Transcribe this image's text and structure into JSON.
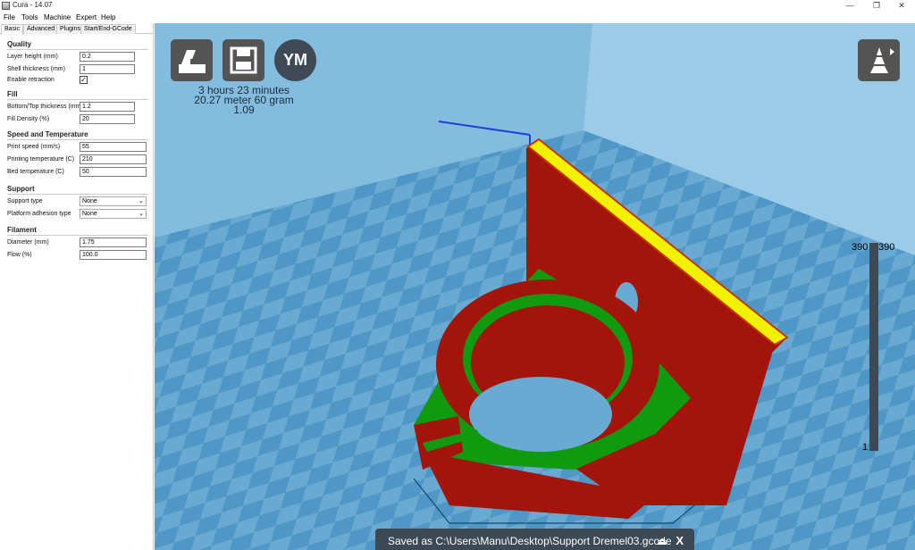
{
  "window": {
    "title": "Cura - 14.07",
    "minimize": "—",
    "restore": "❐",
    "close": "✕"
  },
  "menu": [
    "File",
    "Tools",
    "Machine",
    "Expert",
    "Help"
  ],
  "tabs": [
    "Basic",
    "Advanced",
    "Plugins",
    "Start/End-GCode"
  ],
  "sections": {
    "quality": "Quality",
    "fill": "Fill",
    "speed": "Speed and Temperature",
    "support": "Support",
    "filament": "Filament"
  },
  "fields": {
    "layer_height": {
      "label": "Layer height (mm)",
      "value": "0.2"
    },
    "shell_thickness": {
      "label": "Shell thickness (mm)",
      "value": "1"
    },
    "enable_retraction": {
      "label": "Enable retraction",
      "checked": "✓"
    },
    "bottom_top": {
      "label": "Bottom/Top thickness (mm)",
      "value": "1.2"
    },
    "fill_density": {
      "label": "Fill Density (%)",
      "value": "20"
    },
    "print_speed": {
      "label": "Print speed (mm/s)",
      "value": "55"
    },
    "print_temp": {
      "label": "Printing temperature (C)",
      "value": "210"
    },
    "bed_temp": {
      "label": "Bed temperature (C)",
      "value": "50"
    },
    "support_type": {
      "label": "Support type",
      "value": "None"
    },
    "platform_adhesion": {
      "label": "Platform adhesion type",
      "value": "None"
    },
    "diameter": {
      "label": "Diameter (mm)",
      "value": "1.75"
    },
    "flow": {
      "label": "Flow (%)",
      "value": "100.0"
    }
  },
  "viewport": {
    "ym_label": "YM",
    "print_time": "3 hours 23 minutes",
    "material": "20.27 meter 60 gram",
    "cost": "1.09",
    "layer_top_left": "390",
    "layer_top_right": "390",
    "layer_bottom": "1",
    "toast": "Saved as C:\\Users\\Manu\\Desktop\\Support Dremel03.gcode",
    "toast_close": "X"
  }
}
